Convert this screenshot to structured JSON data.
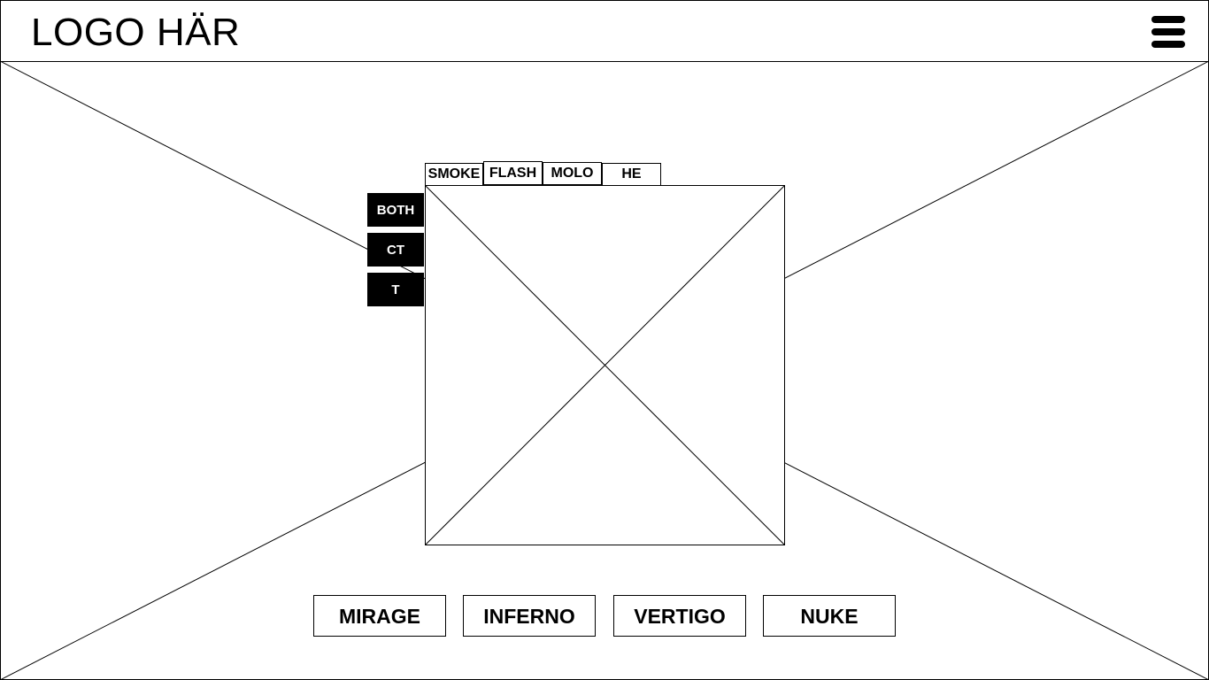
{
  "header": {
    "logo": "LOGO HÄR",
    "menu_icon": "hamburger-menu-icon"
  },
  "viewer": {
    "grenade_tabs": [
      {
        "label": "SMOKE"
      },
      {
        "label": "FLASH"
      },
      {
        "label": "MOLO"
      },
      {
        "label": "HE"
      }
    ],
    "side_filters": [
      {
        "label": "BOTH"
      },
      {
        "label": "CT"
      },
      {
        "label": "T"
      }
    ]
  },
  "maps": [
    {
      "label": "MIRAGE"
    },
    {
      "label": "INFERNO"
    },
    {
      "label": "VERTIGO"
    },
    {
      "label": "NUKE"
    }
  ],
  "colors": {
    "line": "#000000",
    "background": "#ffffff",
    "button_filled": "#000000",
    "button_text_inverse": "#ffffff"
  }
}
